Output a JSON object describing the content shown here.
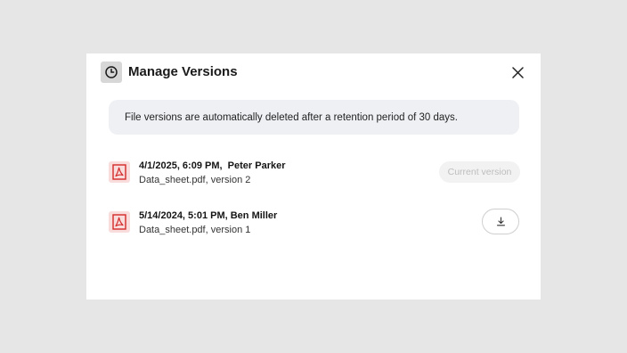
{
  "dialog": {
    "title": "Manage Versions",
    "header_icon": "clock-icon",
    "close_icon": "close-icon",
    "notice": "File versions are automatically deleted after a retention period of 30 days."
  },
  "versions": [
    {
      "title": "4/1/2025, 6:09 PM,  Peter Parker",
      "file": "Data_sheet.pdf, version 2",
      "icon": "pdf-icon",
      "status_label": "Current version"
    },
    {
      "title": "5/14/2024, 5:01 PM, Ben Miller",
      "file": "Data_sheet.pdf, version 1",
      "icon": "pdf-icon",
      "action_icon": "download-icon"
    }
  ],
  "colors": {
    "pdf_red": "#d42a2a",
    "pdf_bg": "#f9dcdc",
    "notice_bg": "#eef0f4",
    "overlay": "#e6e6e6"
  }
}
